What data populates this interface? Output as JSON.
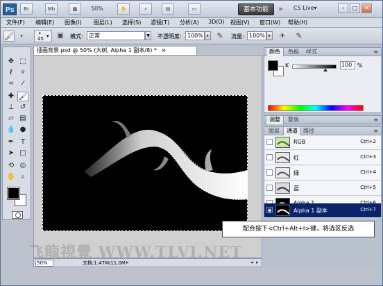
{
  "titlebar": {
    "logo": "Ps",
    "br_button": "Br",
    "mb_button": "Mb",
    "zoom": "50%",
    "workspace": "基本功能",
    "expand": "»",
    "cs_live": "CS Live▾",
    "minimize": "–",
    "restore": "□",
    "close": "✕"
  },
  "menu": [
    "文件(F)",
    "编辑(E)",
    "图像(I)",
    "图层(L)",
    "选择(S)",
    "滤镜(T)",
    "分析(A)",
    "3D(D)",
    "视图(V)",
    "窗口(W)",
    "帮助(H)"
  ],
  "options": {
    "brush_size": "45",
    "mode_label": "模式:",
    "mode_value": "正常",
    "opacity_label": "不透明度:",
    "opacity_value": "100%",
    "flow_label": "流量:",
    "flow_value": "100%"
  },
  "document": {
    "tab_title": "插画背景.psd @ 50% (大树, Alpha 1 副本/8) *",
    "tab_close": "×",
    "zoom": "50%",
    "doc_info": "文档:1.47M/11.0M"
  },
  "color_panel": {
    "tabs": [
      "颜色",
      "色板",
      "样式"
    ],
    "channel_label": "K",
    "value": "100",
    "unit": "%",
    "k_level": 0.75
  },
  "adjust_panel": {
    "tabs": [
      "调整",
      "蒙版"
    ]
  },
  "channels_panel": {
    "tabs": [
      "图层",
      "通道",
      "路径"
    ],
    "rows": [
      {
        "name": "RGB",
        "shortcut": "Ctrl+2"
      },
      {
        "name": "红",
        "shortcut": "Ctrl+3"
      },
      {
        "name": "绿",
        "shortcut": "Ctrl+4"
      },
      {
        "name": "蓝",
        "shortcut": "Ctrl+5"
      },
      {
        "name": "Alpha 1",
        "shortcut": "Ctrl+6"
      },
      {
        "name": "Alpha 1 副本",
        "shortcut": "Ctrl+7"
      }
    ]
  },
  "callout": "配合按下<Ctrl+Alt+I>键，将选区反选",
  "watermark": "飞龍視覺 WWW.TLVI.NET"
}
